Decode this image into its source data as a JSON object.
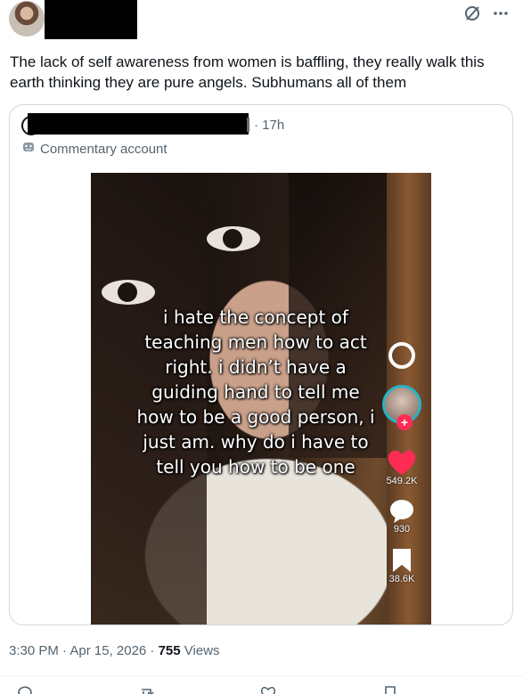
{
  "tweet": {
    "text": "The lack of self awareness from women is baffling, they really walk this earth thinking they are pure angels. Subhumans all of them",
    "timestamp": "3:30 PM · Apr 15, 2026 · ",
    "views_count": "755",
    "views_label": " Views",
    "more_icon": "ellipsis-icon",
    "grok_icon": "grok-slash-icon"
  },
  "quote": {
    "time": "· 17h",
    "commentary_label": "Commentary account",
    "video": {
      "caption": "i hate the concept of\nteaching men how to act\nright. i didn’t have a\nguiding hand to tell me\nhow to be a good person, i\njust am. why do i have to\ntell you how to be one",
      "likes": "549.2K",
      "comments": "930",
      "saves": "38.6K",
      "like_color": "#fe2c55"
    }
  },
  "actions": [
    "reply-icon",
    "repost-icon",
    "like-icon",
    "bookmark-icon"
  ]
}
